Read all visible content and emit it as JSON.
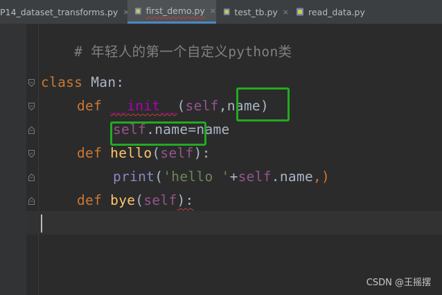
{
  "tabs": [
    {
      "label": "P14_dataset_transforms.py",
      "active": false,
      "closable": true
    },
    {
      "label": "first_demo.py",
      "active": true,
      "closable": true
    },
    {
      "label": "test_tb.py",
      "active": false,
      "closable": true
    },
    {
      "label": "read_data.py",
      "active": false,
      "closable": false
    }
  ],
  "close_glyph": "×",
  "code": {
    "comment": "# 年轻人的第一个自定义python类",
    "class_kw": "class",
    "class_name": " Man:",
    "def_kw": "def",
    "init_name": "__init__",
    "open_paren": "(",
    "self": "self",
    "comma": ",",
    "name_param": "name",
    "close_paren_colon": ")",
    "dot_name": ".name",
    "assign_name": "=name",
    "hello_name": "hello",
    "paren_self_close": "):",
    "print_name": "print",
    "hello_str": "'hello '",
    "plus": "+",
    "tail": ",)",
    "bye_name": "bye"
  },
  "icons": {
    "file": "python-file-icon",
    "fold": "fold-marker-icon"
  },
  "colors": {
    "highlight": "#22aa22",
    "keyword": "#cc7832",
    "function": "#ffc66d",
    "self": "#94558d"
  },
  "watermark": "CSDN @王摇摆"
}
